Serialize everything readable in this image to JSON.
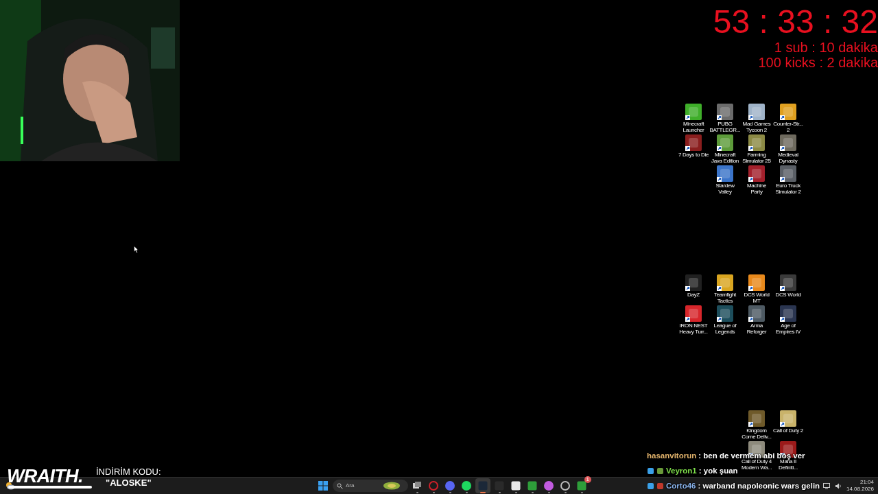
{
  "timer": {
    "time": "53 : 33 : 32",
    "rules": [
      "1 sub : 10 dakika",
      "100 kicks : 2 dakika"
    ]
  },
  "desktop_groups": [
    {
      "rows": [
        [
          {
            "label": "Minecraft Launcher",
            "color": "#3fae2a"
          },
          {
            "label": "PUBG BATTLEGR...",
            "color": "#6b6b6b"
          },
          {
            "label": "Mad Games Tycoon 2",
            "color": "#9fb3c8"
          },
          {
            "label": "Counter-Str... 2",
            "color": "#e0a020"
          }
        ],
        [
          {
            "label": "7 Days to Die",
            "color": "#8a1e1e"
          },
          {
            "label": "Minecraft Java Edition",
            "color": "#5d9b3a"
          },
          {
            "label": "Farming Simulator 25",
            "color": "#8c8a45"
          },
          {
            "label": "Medieval Dynasty",
            "color": "#6e6a5e"
          }
        ],
        [
          "",
          {
            "label": "Stardew Valley",
            "color": "#3b74c9"
          },
          {
            "label": "Machine Party",
            "color": "#a3202c"
          },
          {
            "label": "Euro Truck Simulator 2",
            "color": "#5a5f66"
          }
        ]
      ]
    },
    {
      "rows": [
        [
          {
            "label": "DayZ",
            "color": "#202020"
          },
          {
            "label": "Teamfight Tactics",
            "color": "#d9a520"
          },
          {
            "label": "DCS World MT",
            "color": "#e8891c"
          },
          {
            "label": "DCS World",
            "color": "#3a3a3a"
          }
        ],
        [
          {
            "label": "IRON NEST Heavy Turr...",
            "color": "#d7262b"
          },
          {
            "label": "League of Legends",
            "color": "#1d4e5c"
          },
          {
            "label": "Arma Reforger",
            "color": "#4e5a63"
          },
          {
            "label": "Age of Empires IV",
            "color": "#2a3550"
          }
        ]
      ]
    },
    {
      "rows": [
        [
          "",
          "",
          {
            "label": "Kingdom Come Deliv...",
            "color": "#6f5a2a"
          },
          {
            "label": "Call of Duty 2",
            "color": "#c9b36a"
          }
        ],
        [
          "",
          "",
          {
            "label": "Call of Duty 4 Modern Wa...",
            "color": "#8d8a7c"
          },
          {
            "label": "Mafia II Definiti...",
            "color": "#9c1a1a"
          }
        ]
      ]
    }
  ],
  "sponsor": {
    "brand": "WRAITH.",
    "caption": "İNDİRİM KODU:",
    "code": "\"ALOSKE\""
  },
  "chat": [
    {
      "user": "hasanvitorun",
      "color": "#e3b46c",
      "message": ": ben de vermem abi boş ver"
    },
    {
      "user": "Veyron1",
      "color": "#7fe04a",
      "message": ": yok şuan",
      "badges": [
        {
          "color": "#3aa0e8"
        },
        {
          "color": "#6a9a3a"
        }
      ]
    },
    {
      "user": "Corto46",
      "color": "#8ab4ec",
      "message": ": warband napoleonic wars gelin",
      "badges": [
        {
          "color": "#3aa0e8"
        },
        {
          "color": "#c0392b"
        }
      ]
    }
  ],
  "taskbar": {
    "search": {
      "placeholder": "Ara"
    },
    "apps": [
      {
        "kind": "taskview",
        "color": "#d0d0d0",
        "selected": false
      },
      {
        "kind": "ring",
        "color": "#d0202a",
        "selected": false
      },
      {
        "kind": "round",
        "color": "#5865f2",
        "selected": false
      },
      {
        "kind": "round",
        "color": "#1ed760",
        "selected": false
      },
      {
        "kind": "square",
        "color": "#1b2838",
        "selected": true
      },
      {
        "kind": "square",
        "color": "#2a2a2a",
        "selected": false
      },
      {
        "kind": "square",
        "color": "#e8e8e8",
        "selected": false
      },
      {
        "kind": "square",
        "color": "#2e9e3a",
        "selected": false
      },
      {
        "kind": "round",
        "color": "#c25be0",
        "selected": false
      },
      {
        "kind": "ring",
        "color": "#bbbbbb",
        "selected": false
      },
      {
        "kind": "square",
        "color": "#2e9e3a",
        "selected": false,
        "badge": "1"
      }
    ],
    "clock": {
      "time": "21:04",
      "date": "14.08.2026"
    }
  }
}
